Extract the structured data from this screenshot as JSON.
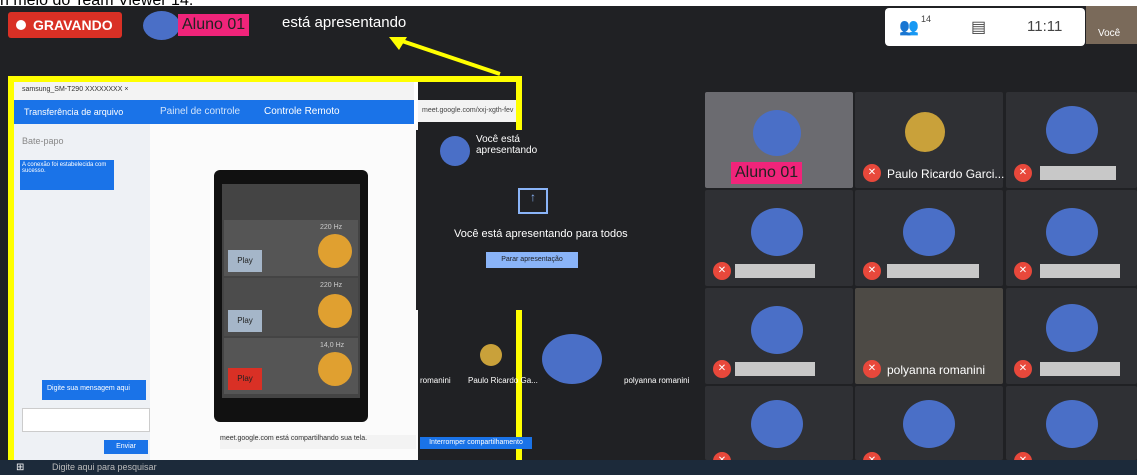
{
  "caption": "ri meio do Team Viewer 14.",
  "meet": {
    "record_label": "GRAVANDO",
    "presenter_name": "Aluno 01",
    "presenting_text": "está apresentando",
    "participants_count": "14",
    "time": "11:11",
    "self_label": "Você"
  },
  "teamviewer": {
    "window_title": "samsung_SM-T290 XXXXXXXX ×",
    "file_transfer": "Transferência de arquivo",
    "tab_control_panel": "Painel de controle",
    "tab_remote": "Controle Remoto",
    "chat_title": "Bate-papo",
    "chat_msg": "A conexão foi estabelecida com sucesso.",
    "chat_placeholder": "Digite sua mensagem aqui",
    "send_label": "Enviar",
    "freqs": [
      "220 Hz",
      "220 Hz",
      "14,0 Hz"
    ],
    "play_label": "Play"
  },
  "meet_inner": {
    "url": "meet.google.com/xxj-xgth-fev",
    "presenting_heading": "Você está apresentando",
    "presenting_all": "Você está apresentando para todos",
    "stop_label": "Parar apresentação",
    "share_notice": "meet.google.com está compartilhando sua tela.",
    "stop_share_label": "Interromper compartilhamento",
    "tiles": [
      "romanini",
      "Paulo Ricardo Ga...",
      "polyanna romanini"
    ]
  },
  "grid": {
    "tile_names": [
      "Paulo Ricardo Garci...",
      "polyanna romanini"
    ]
  },
  "taskbar": {
    "search_placeholder": "Digite aqui para pesquisar"
  }
}
